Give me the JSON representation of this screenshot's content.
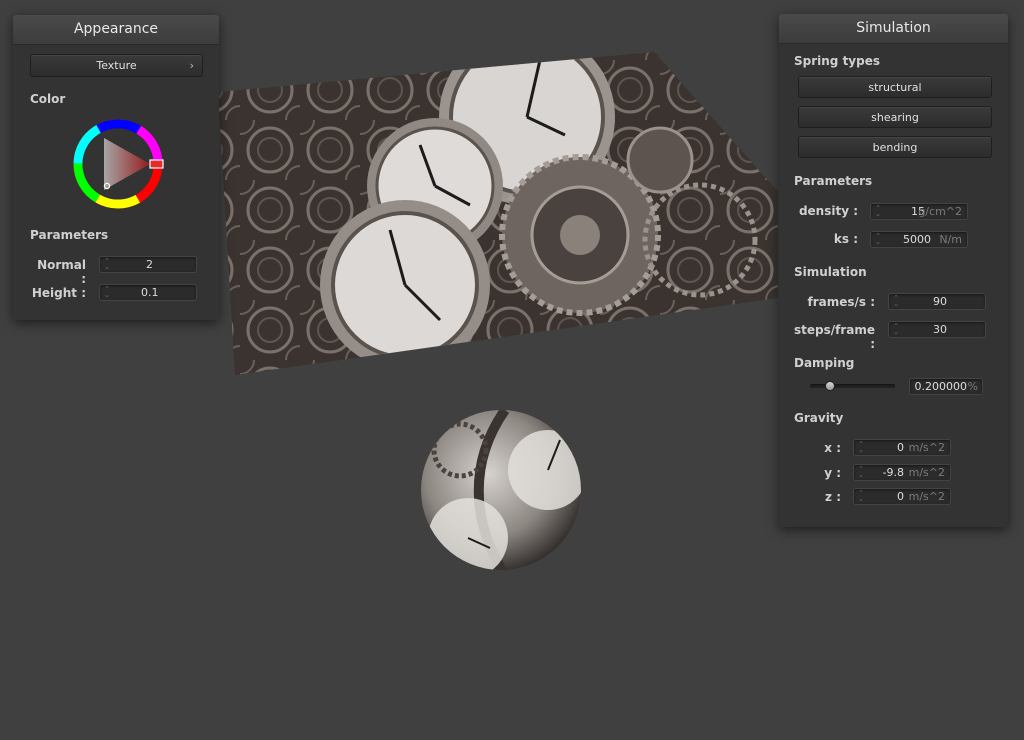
{
  "appearance": {
    "title": "Appearance",
    "texture_button": "Texture",
    "chevron": "›",
    "color_label": "Color",
    "parameters_label": "Parameters",
    "normal_label": "Normal :",
    "normal_value": "2",
    "height_label": "Height :",
    "height_value": "0.1"
  },
  "simulation": {
    "title": "Simulation",
    "spring_types_label": "Spring types",
    "spring_types": [
      "structural",
      "shearing",
      "bending"
    ],
    "parameters_label": "Parameters",
    "density_label": "density :",
    "density_value": "15",
    "density_unit": "g/cm^2",
    "ks_label": "ks :",
    "ks_value": "5000",
    "ks_unit": "N/m",
    "simulation_label": "Simulation",
    "fps_label": "frames/s :",
    "fps_value": "90",
    "steps_label": "steps/frame :",
    "steps_value": "30",
    "damping_label": "Damping",
    "damping_value": "0.200000",
    "damping_unit": "%",
    "damping_fraction": 0.2,
    "gravity_label": "Gravity",
    "gx_label": "x :",
    "gx_value": "0",
    "gy_label": "y :",
    "gy_value": "-9.8",
    "gz_label": "z :",
    "gz_value": "0",
    "g_unit": "m/s^2"
  },
  "colors": {
    "background": "#404040",
    "panel": "#333333",
    "picked_color": "#e52b2b"
  }
}
